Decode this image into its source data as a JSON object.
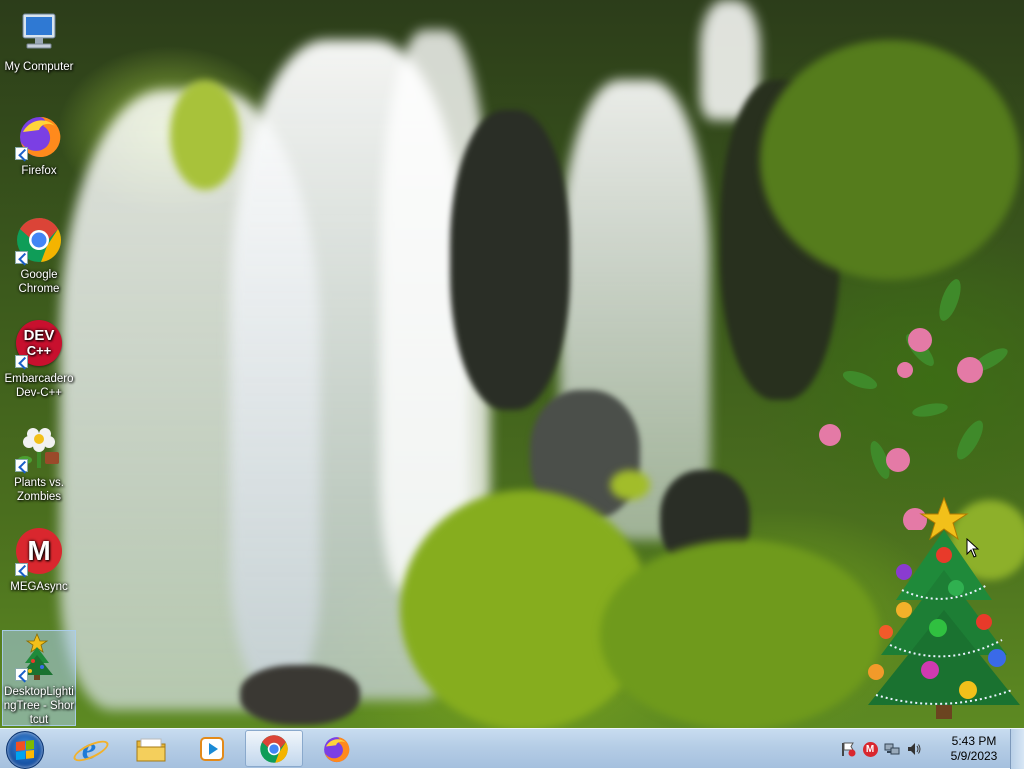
{
  "desktop": {
    "icons": [
      {
        "label": "My Computer",
        "icon": "computer-icon"
      },
      {
        "label": "Firefox",
        "icon": "firefox-icon"
      },
      {
        "label": "Google Chrome",
        "icon": "chrome-icon"
      },
      {
        "label": "Embarcadero Dev-C++",
        "icon": "devcpp-icon",
        "badge": "DEV",
        "badge2": "C++"
      },
      {
        "label": "Plants vs. Zombies",
        "icon": "plants-vs-zombies-icon"
      },
      {
        "label": "MEGAsync",
        "icon": "mega-icon",
        "badge": "M"
      },
      {
        "label": "DesktopLightingTree - Shortcut",
        "icon": "christmas-tree-icon"
      }
    ]
  },
  "taskbar": {
    "pinned": [
      {
        "name": "internet-explorer",
        "icon": "ie-icon",
        "glyph": "e"
      },
      {
        "name": "file-explorer",
        "icon": "folder-icon"
      },
      {
        "name": "media-player",
        "icon": "media-player-icon"
      },
      {
        "name": "chrome",
        "icon": "chrome-icon"
      },
      {
        "name": "firefox",
        "icon": "firefox-icon"
      }
    ],
    "tray": {
      "mega_badge": "M"
    },
    "clock": {
      "time": "5:43 PM",
      "date": "5/9/2023"
    }
  },
  "colors": {
    "taskbar": "#b5cde6",
    "chrome_red": "#db4437",
    "chrome_green": "#0f9d58",
    "chrome_yellow": "#f4b400",
    "chrome_blue": "#4285f4",
    "mega_red": "#d9272e",
    "devcpp_red": "#c8102e"
  }
}
